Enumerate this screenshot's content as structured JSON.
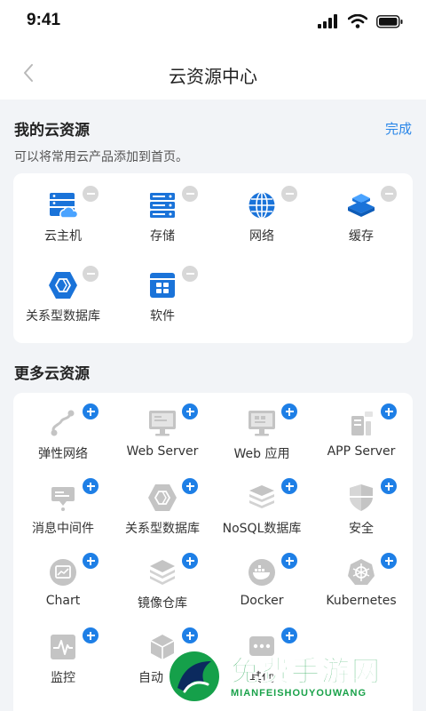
{
  "status_bar": {
    "time": "9:41"
  },
  "nav": {
    "title": "云资源中心"
  },
  "my_resources": {
    "title": "我的云资源",
    "done_label": "完成",
    "subtitle": "可以将常用云产品添加到首页。",
    "items": [
      {
        "label": "云主机",
        "icon": "cloud-server-icon"
      },
      {
        "label": "存储",
        "icon": "storage-icon"
      },
      {
        "label": "网络",
        "icon": "globe-icon"
      },
      {
        "label": "缓存",
        "icon": "cache-icon"
      },
      {
        "label": "关系型数据库",
        "icon": "hexagon-icon"
      },
      {
        "label": "软件",
        "icon": "software-icon"
      }
    ]
  },
  "more_resources": {
    "title": "更多云资源",
    "items": [
      {
        "label": "弹性网络",
        "icon": "cable-icon"
      },
      {
        "label": "Web Server",
        "icon": "monitor-icon"
      },
      {
        "label": "Web 应用",
        "icon": "monitor-app-icon"
      },
      {
        "label": "APP Server",
        "icon": "app-server-icon"
      },
      {
        "label": "消息中间件",
        "icon": "message-icon"
      },
      {
        "label": "关系型数据库",
        "icon": "hexagon-icon"
      },
      {
        "label": "NoSQL数据库",
        "icon": "database-icon"
      },
      {
        "label": "安全",
        "icon": "shield-icon"
      },
      {
        "label": "Chart",
        "icon": "chart-icon"
      },
      {
        "label": "镜像仓库",
        "icon": "layers-icon"
      },
      {
        "label": "Docker",
        "icon": "docker-icon"
      },
      {
        "label": "Kubernetes",
        "icon": "kubernetes-icon"
      },
      {
        "label": "监控",
        "icon": "pulse-icon"
      },
      {
        "label": "自动",
        "icon": "cube-icon"
      },
      {
        "label": "其他",
        "icon": "more-icon"
      }
    ]
  },
  "watermark": {
    "title": "免费手游网",
    "subtitle": "MIANFEISHOUYOUWANG"
  },
  "colors": {
    "accent": "#2a86e8",
    "badge_add": "#1e7fe6",
    "badge_remove": "#d8d8d8",
    "icon_blue": "#1a73d9",
    "icon_gray": "#c4c4c4",
    "watermark": "#1aa24a"
  }
}
